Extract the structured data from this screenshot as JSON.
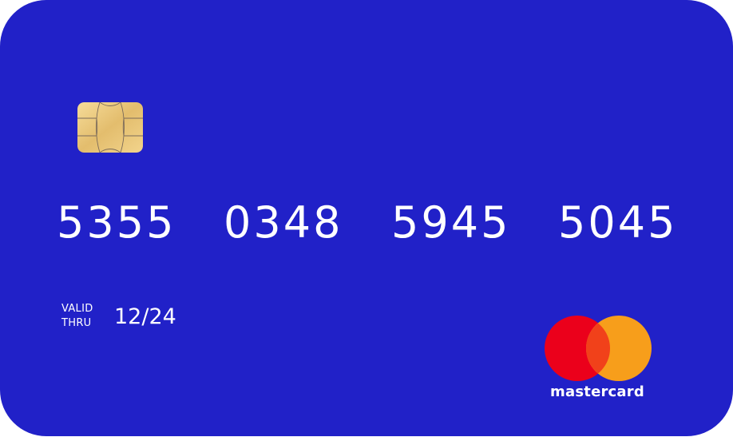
{
  "card": {
    "background_color": "#2121c8",
    "chip": {
      "icon": "card-chip-icon",
      "color": "#e6c47a"
    },
    "number_groups": [
      "5355",
      "0348",
      "5945",
      "5045"
    ],
    "valid_label_line1": "VALID",
    "valid_label_line2": "THRU",
    "expiry": "12/24",
    "brand": {
      "name": "mastercard",
      "icon": "mastercard-logo-icon",
      "colors": {
        "red": "#eb001b",
        "orange": "#f79e1b",
        "overlap": "#ff5f00"
      }
    }
  }
}
